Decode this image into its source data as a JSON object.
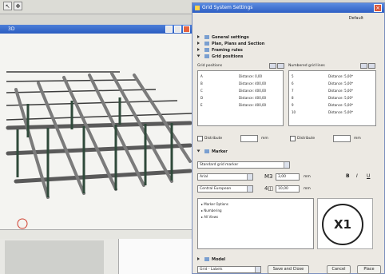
{
  "left_toolbar": {
    "icons": [
      "arrow-icon",
      "cursor-icon"
    ]
  },
  "viewport": {
    "title": "3D"
  },
  "dialog": {
    "title": "Grid System Settings",
    "default_label": "Default",
    "sections": [
      {
        "label": "General settings"
      },
      {
        "label": "Plan, Plans and Section"
      },
      {
        "label": "Framing rules"
      },
      {
        "label": "Grid positions"
      }
    ],
    "letter_list": {
      "header": "Grid positions",
      "rows": [
        {
          "name": "A",
          "distance": "Distance: 0,00"
        },
        {
          "name": "B",
          "distance": "Distance: 400,00"
        },
        {
          "name": "C",
          "distance": "Distance: 400,00"
        },
        {
          "name": "D",
          "distance": "Distance: 400,00"
        },
        {
          "name": "E",
          "distance": "Distance: 400,00"
        }
      ]
    },
    "number_list": {
      "header": "Numbered grid lines",
      "rows": [
        {
          "name": "5",
          "distance": "Distance: 5,00*"
        },
        {
          "name": "6",
          "distance": "Distance: 5,00*"
        },
        {
          "name": "7",
          "distance": "Distance: 5,00*"
        },
        {
          "name": "8",
          "distance": "Distance: 5,00*"
        },
        {
          "name": "9",
          "distance": "Distance: 5,00*"
        },
        {
          "name": "10",
          "distance": "Distance: 5,00*"
        }
      ]
    },
    "distribute_left": "Distribute",
    "distribute_right": "Distribute",
    "unit_left": "mm",
    "unit_right": "mm",
    "marker_section": "Marker",
    "marker_type": "Standard grid marker",
    "font_name": "Arial",
    "encoding": "Central European",
    "size_value": "3,00",
    "size_unit": "mm",
    "offset_value": "10,00",
    "offset_unit": "mm",
    "style_buttons": [
      "B",
      "I",
      "U"
    ],
    "options": [
      "Marker Options",
      "Numbering",
      "All Views"
    ],
    "marker_preview": "X1",
    "model_section": "Model",
    "footer_combo": "Grid - Labels",
    "save_button": "Save and Close",
    "cancel_button": "Cancel",
    "place_button": "Place"
  }
}
